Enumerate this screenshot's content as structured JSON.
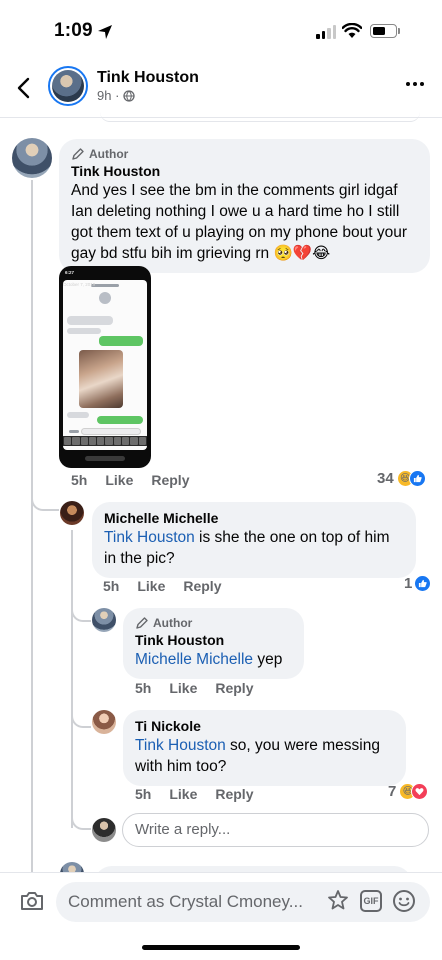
{
  "status_bar": {
    "time": "1:09"
  },
  "header": {
    "name": "Tink Houston",
    "time_ago": "9h ·",
    "icons": [
      "back-chevron-icon",
      "globe-icon",
      "more-dots-icon"
    ]
  },
  "comments": [
    {
      "badge": "Author",
      "name": "Tink Houston",
      "text": "And yes I see the bm in the comments girl idgaf Ian deleting nothing I owe u a hard time ho I still got them text of u playing on my phone bout your gay bd stfu bih im grieving rn 🥺💔😂",
      "age": "5h",
      "like": "Like",
      "reply": "Reply",
      "reactions": "34",
      "reaction_icons": [
        "haha-icon",
        "like-icon"
      ],
      "screenshot": {
        "time": "6:27",
        "date": "October 7, 2019"
      }
    },
    {
      "name": "Michelle Michelle",
      "mention": "Tink Houston",
      "text": " is she the one on top of him in the pic?",
      "age": "5h",
      "like": "Like",
      "reply": "Reply",
      "reactions": "1",
      "reaction_icons": [
        "like-icon"
      ]
    },
    {
      "badge": "Author",
      "name": "Tink Houston",
      "mention": "Michelle Michelle",
      "text": " yep",
      "age": "5h",
      "like": "Like",
      "reply": "Reply"
    },
    {
      "name": "Ti Nickole",
      "mention": "Tink Houston",
      "text": " so, you were messing with him too?",
      "age": "5h",
      "like": "Like",
      "reply": "Reply",
      "reactions": "7",
      "reaction_icons": [
        "haha-icon",
        "love-icon"
      ]
    }
  ],
  "reply_input": {
    "placeholder": "Write a reply..."
  },
  "composer": {
    "placeholder": "Comment as Crystal Cmoney..."
  },
  "colors": {
    "accent": "#1877f2",
    "mention": "#1b5fb3",
    "bubble": "#f0f2f5",
    "muted": "#65676b"
  }
}
